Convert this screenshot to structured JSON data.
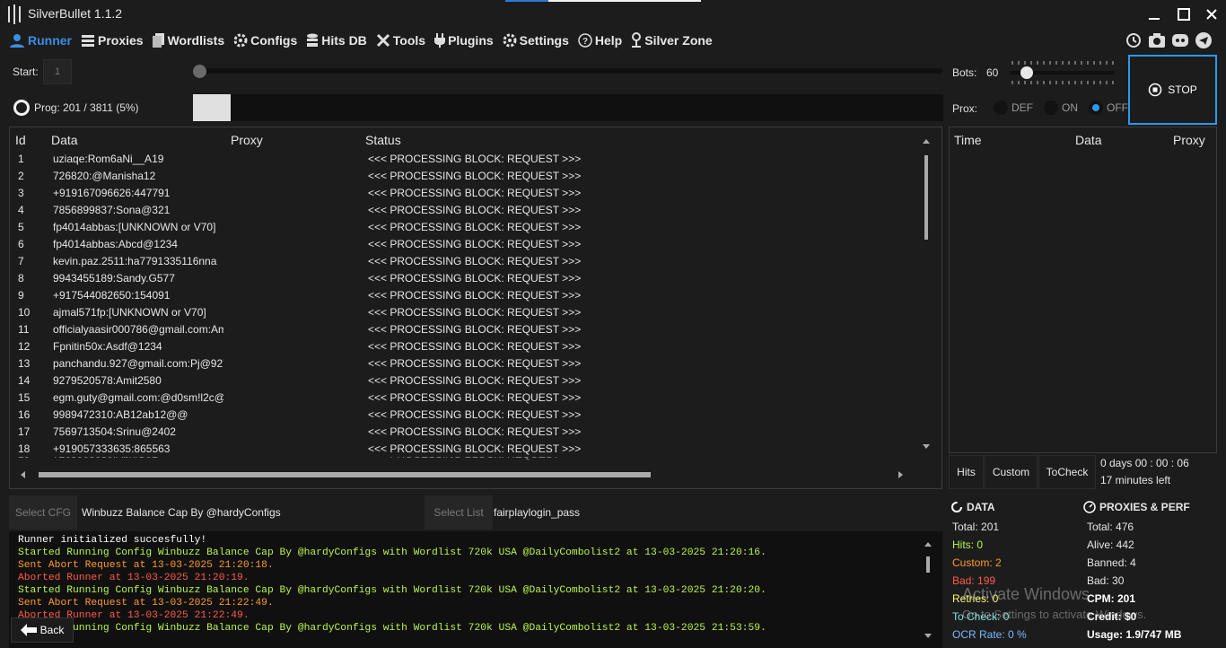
{
  "app": {
    "title": "SilverBullet 1.1.2"
  },
  "nav": [
    {
      "label": "Runner"
    },
    {
      "label": "Proxies"
    },
    {
      "label": "Wordlists"
    },
    {
      "label": "Configs"
    },
    {
      "label": "Hits DB"
    },
    {
      "label": "Tools"
    },
    {
      "label": "Plugins"
    },
    {
      "label": "Settings"
    },
    {
      "label": "Help"
    },
    {
      "label": "Silver Zone"
    }
  ],
  "controls": {
    "start_label": "Start:",
    "start_value": "1",
    "prog_label": "Prog:",
    "prog_value": "201  /  3811  (5%)",
    "progress_fraction": 0.05,
    "bots_label": "Bots:",
    "bots_value": "60",
    "prox_label": "Prox:",
    "prox_options": [
      "DEF",
      "ON",
      "OFF"
    ],
    "prox_selected": "OFF",
    "stop_label": "STOP"
  },
  "grid": {
    "headers": [
      "Id",
      "Data",
      "Proxy",
      "Status"
    ],
    "rows": [
      {
        "id": "1",
        "data": "uziaqe:Rom6aNi__A19",
        "status": "<<< PROCESSING BLOCK: REQUEST >>>"
      },
      {
        "id": "2",
        "data": "726820:@Manisha12",
        "status": "<<< PROCESSING BLOCK: REQUEST >>>"
      },
      {
        "id": "3",
        "data": "+919167096626:447791",
        "status": "<<< PROCESSING BLOCK: REQUEST >>>"
      },
      {
        "id": "4",
        "data": "7856899837:Sona@321",
        "status": "<<< PROCESSING BLOCK: REQUEST >>>"
      },
      {
        "id": "5",
        "data": "fp4014abbas:[UNKNOWN or V70]",
        "status": "<<< PROCESSING BLOCK: REQUEST >>>"
      },
      {
        "id": "6",
        "data": "fp4014abbas:Abcd@1234",
        "status": "<<< PROCESSING BLOCK: REQUEST >>>"
      },
      {
        "id": "7",
        "data": "kevin.paz.2511:ha7791335116nna",
        "status": "<<< PROCESSING BLOCK: REQUEST >>>"
      },
      {
        "id": "8",
        "data": "9943455189:Sandy.G577",
        "status": "<<< PROCESSING BLOCK: REQUEST >>>"
      },
      {
        "id": "9",
        "data": "+917544082650:154091",
        "status": "<<< PROCESSING BLOCK: REQUEST >>>"
      },
      {
        "id": "10",
        "data": "ajmal571fp:[UNKNOWN or V70]",
        "status": "<<< PROCESSING BLOCK: REQUEST >>>"
      },
      {
        "id": "11",
        "data": "officialyaasir000786@gmail.com:Am",
        "status": "<<< PROCESSING BLOCK: REQUEST >>>"
      },
      {
        "id": "12",
        "data": "Fpnitin50x:Asdf@1234",
        "status": "<<< PROCESSING BLOCK: REQUEST >>>"
      },
      {
        "id": "13",
        "data": "panchandu.927@gmail.com:Pj@927",
        "status": "<<< PROCESSING BLOCK: REQUEST >>>"
      },
      {
        "id": "14",
        "data": "9279520578:Amit2580",
        "status": "<<< PROCESSING BLOCK: REQUEST >>>"
      },
      {
        "id": "15",
        "data": "egm.guty@gmail.com:@d0sm!l2c@",
        "status": "<<< PROCESSING BLOCK: REQUEST >>>"
      },
      {
        "id": "16",
        "data": "9989472310:AB12ab12@@",
        "status": "<<< PROCESSING BLOCK: REQUEST >>>"
      },
      {
        "id": "17",
        "data": "7569713504:Srinu@2402",
        "status": "<<< PROCESSING BLOCK: REQUEST >>>"
      },
      {
        "id": "18",
        "data": "+919057333635:865563",
        "status": "<<< PROCESSING BLOCK: REQUEST >>>"
      }
    ]
  },
  "hits_panel": {
    "headers": [
      "Time",
      "Data",
      "Proxy"
    ]
  },
  "tabs": [
    "Hits",
    "Custom",
    "ToCheck"
  ],
  "timer": {
    "elapsed": "0  days  00 : 00 : 06",
    "remaining": "17 minutes left"
  },
  "config_bar": {
    "select_cfg_label": "Select CFG",
    "cfg_value": "Winbuzz Balance Cap By @hardyConfigs",
    "select_list_label": "Select List",
    "list_value": "fairplaylogin_pass"
  },
  "log": [
    {
      "text": "Runner initialized succesfully!",
      "color": "#ffffff"
    },
    {
      "text": "Started Running Config Winbuzz Balance Cap By @hardyConfigs with Wordlist 720k USA @DailyCombolist2 at 13-03-2025 21:20:16.",
      "color": "#b6f54a"
    },
    {
      "text": "Sent Abort Request at 13-03-2025 21:20:18.",
      "color": "#ff9a2e"
    },
    {
      "text": "Aborted Runner at 13-03-2025 21:20:19.",
      "color": "#ff5a4a"
    },
    {
      "text": "Started Running Config Winbuzz Balance Cap By @hardyConfigs with Wordlist 720k USA @DailyCombolist2 at 13-03-2025 21:20:20.",
      "color": "#b6f54a"
    },
    {
      "text": "Sent Abort Request at 13-03-2025 21:22:49.",
      "color": "#ff9a2e"
    },
    {
      "text": "Aborted Runner at 13-03-2025 21:22:49.",
      "color": "#ff5a4a"
    },
    {
      "text": "Started Running Config Winbuzz Balance Cap By @hardyConfigs with Wordlist 720k USA @DailyCombolist2 at 13-03-2025 21:53:59.",
      "color": "#b6f54a"
    }
  ],
  "back_label": "Back",
  "data_stats": {
    "title": "DATA",
    "total": "Total:  201",
    "hits": "Hits:  0",
    "custom": "Custom:  2",
    "bad": "Bad:  199",
    "retries": "Retries:  0",
    "tocheck": "To Check:  0",
    "ocr": "OCR Rate:  0 %"
  },
  "proxy_stats": {
    "title": "PROXIES & PERF",
    "total": "Total:  476",
    "alive": "Alive:  442",
    "banned": "Banned:  4",
    "bad": "Bad:  30",
    "cpm": "CPM:  201",
    "credit": "Credit:  $0",
    "usage": "Usage:  1.9/747 MB"
  },
  "watermark": {
    "line1": "Activate Windows",
    "line2": "Go to Settings to activate Windows."
  },
  "colors": {
    "accent": "#2b99e6",
    "hits": "#b6f54a",
    "custom": "#ff9a2e",
    "bad": "#ff5a4a",
    "retries": "#ffff66",
    "tocheck": "#7fe0e0",
    "ocr": "#7ab8ff"
  }
}
